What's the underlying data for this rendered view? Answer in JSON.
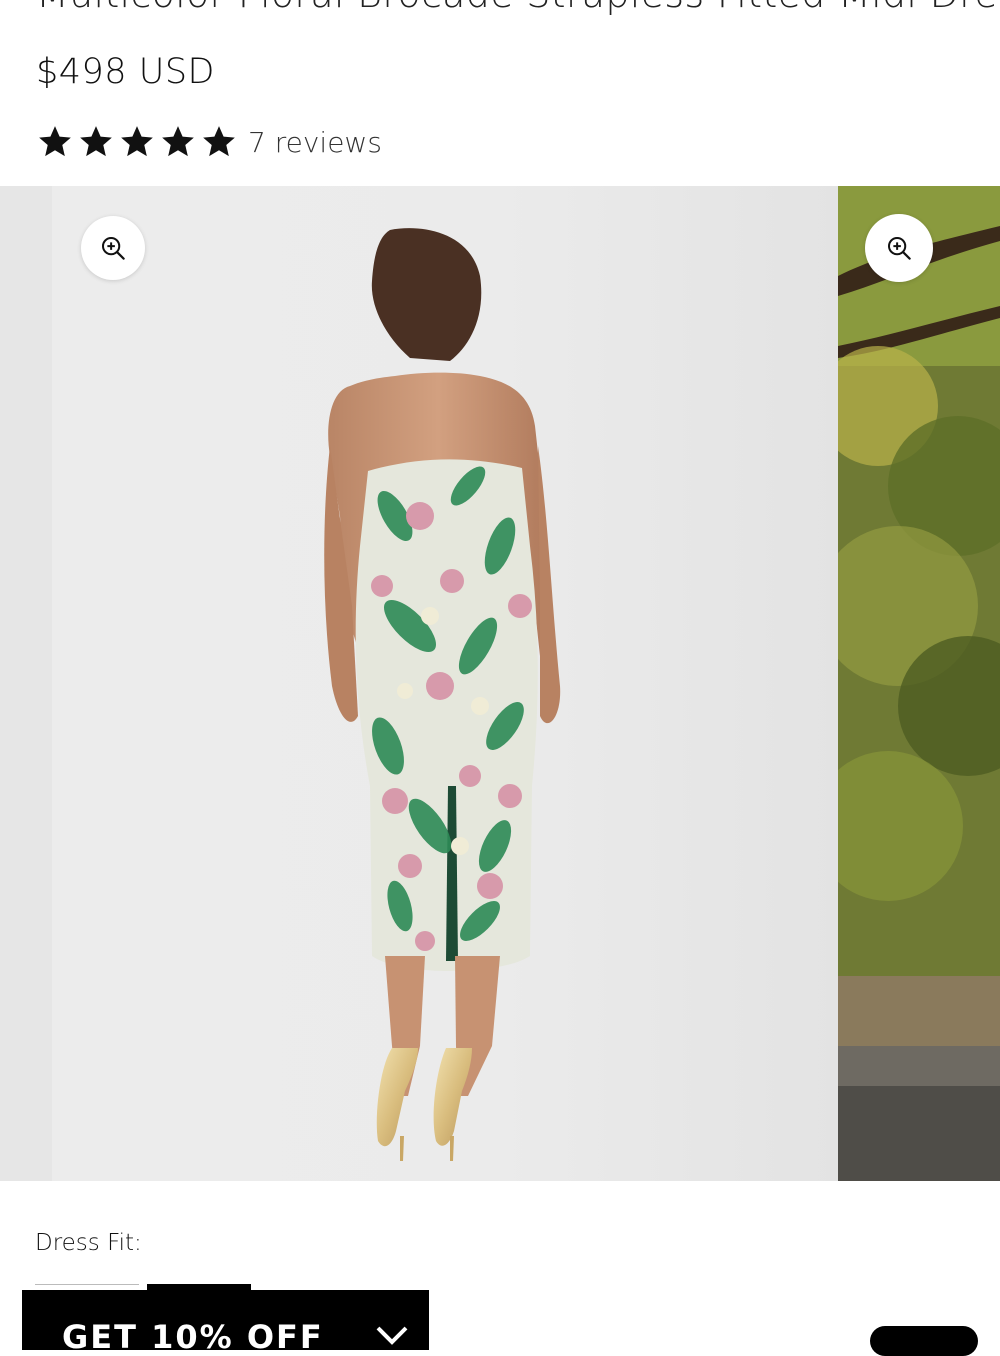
{
  "product": {
    "title": "Multicolor Floral Brocade Strapless Fitted Midi Dress",
    "price": "$498 USD",
    "rating": {
      "stars": 5,
      "reviews_label": "7 reviews"
    }
  },
  "gallery": {
    "slides": [
      {
        "image": "back view of model in strapless floral brocade midi dress",
        "zoom_icon": "zoom-in-icon"
      },
      {
        "image": "outdoor garden photo",
        "zoom_icon": "zoom-in-icon"
      }
    ]
  },
  "options": {
    "label": "Dress Fit:"
  },
  "promo": {
    "label": "GET 10% OFF",
    "icon": "chevron-down-icon"
  },
  "colors": {
    "text": "#111111",
    "promo_bg": "#000000",
    "dress_print": "#2e8b57"
  }
}
